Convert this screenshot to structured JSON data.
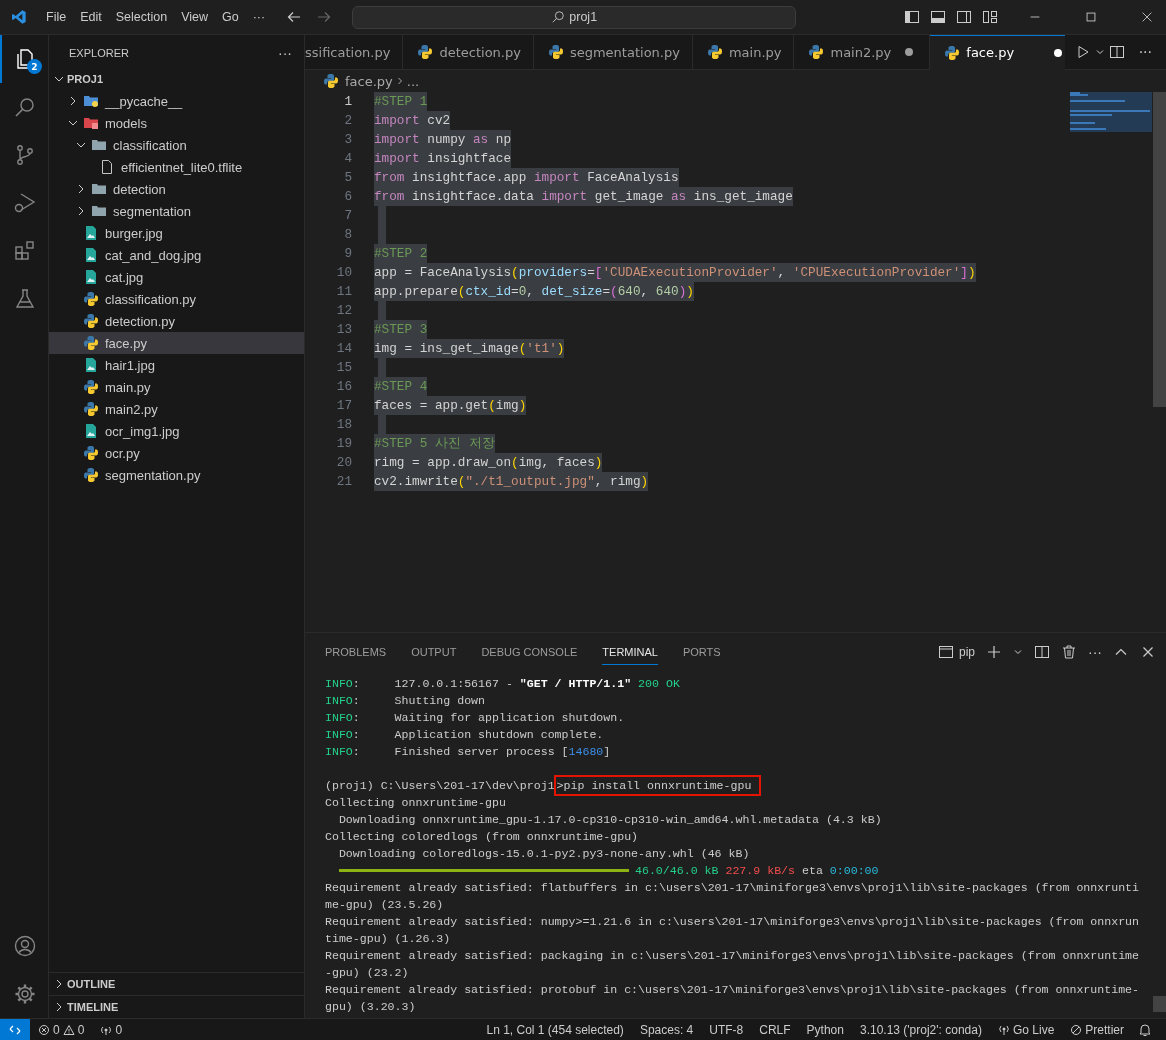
{
  "title_bar": {
    "menu": [
      "File",
      "Edit",
      "Selection",
      "View",
      "Go",
      "···"
    ],
    "search": "proj1"
  },
  "activity_bar": {
    "badge": "2"
  },
  "explorer": {
    "title": "EXPLORER",
    "more": "···",
    "root": "PROJ1",
    "tree": [
      {
        "name": "__pycache__",
        "kind": "pyfolder",
        "expanded": false,
        "selected": false
      },
      {
        "name": "models",
        "kind": "redfolder",
        "expanded": true,
        "selected": false,
        "children": [
          {
            "name": "classification",
            "kind": "folder",
            "expanded": true,
            "selected": false,
            "children": [
              {
                "name": "efficientnet_lite0.tflite",
                "kind": "file",
                "selected": false
              }
            ]
          },
          {
            "name": "detection",
            "kind": "folder",
            "expanded": false,
            "selected": false
          },
          {
            "name": "segmentation",
            "kind": "folder",
            "expanded": false,
            "selected": false
          }
        ]
      },
      {
        "name": "burger.jpg",
        "kind": "image",
        "selected": false
      },
      {
        "name": "cat_and_dog.jpg",
        "kind": "image",
        "selected": false
      },
      {
        "name": "cat.jpg",
        "kind": "image",
        "selected": false
      },
      {
        "name": "classification.py",
        "kind": "python",
        "selected": false
      },
      {
        "name": "detection.py",
        "kind": "python",
        "selected": false
      },
      {
        "name": "face.py",
        "kind": "python",
        "selected": true
      },
      {
        "name": "hair1.jpg",
        "kind": "image",
        "selected": false
      },
      {
        "name": "main.py",
        "kind": "python",
        "selected": false
      },
      {
        "name": "main2.py",
        "kind": "python",
        "selected": false
      },
      {
        "name": "ocr_img1.jpg",
        "kind": "image",
        "selected": false
      },
      {
        "name": "ocr.py",
        "kind": "python",
        "selected": false
      },
      {
        "name": "segmentation.py",
        "kind": "python",
        "selected": false
      }
    ]
  },
  "tabs": [
    {
      "label": "ssification.py",
      "selected": false,
      "modified": false,
      "icon": false
    },
    {
      "label": "detection.py",
      "selected": false,
      "modified": false,
      "icon": true
    },
    {
      "label": "segmentation.py",
      "selected": false,
      "modified": false,
      "icon": true
    },
    {
      "label": "main.py",
      "selected": false,
      "modified": false,
      "icon": true
    },
    {
      "label": "main2.py",
      "selected": false,
      "modified": true,
      "icon": true
    },
    {
      "label": "face.py",
      "selected": true,
      "modified": true,
      "icon": true
    }
  ],
  "editor_actions_more": "···",
  "breadcrumb": {
    "file": "face.py",
    "rest": "..."
  },
  "editor": {
    "lines": [
      {
        "n": "1",
        "current": true,
        "selected": true,
        "tokens": [
          {
            "t": "#STEP 1",
            "kind": "cm"
          }
        ]
      },
      {
        "n": "2",
        "current": false,
        "selected": true,
        "tokens": [
          {
            "t": "import",
            "kind": "kw"
          },
          {
            "t": " cv2",
            "kind": "p"
          }
        ]
      },
      {
        "n": "3",
        "current": false,
        "selected": true,
        "tokens": [
          {
            "t": "import",
            "kind": "kw"
          },
          {
            "t": " numpy ",
            "kind": "p"
          },
          {
            "t": "as",
            "kind": "kw"
          },
          {
            "t": " np",
            "kind": "p"
          }
        ]
      },
      {
        "n": "4",
        "current": false,
        "selected": true,
        "tokens": [
          {
            "t": "import",
            "kind": "kw"
          },
          {
            "t": " insightface",
            "kind": "p"
          }
        ]
      },
      {
        "n": "5",
        "current": false,
        "selected": true,
        "tokens": [
          {
            "t": "from",
            "kind": "kw"
          },
          {
            "t": " insightface.app ",
            "kind": "p"
          },
          {
            "t": "import",
            "kind": "kw"
          },
          {
            "t": " FaceAnalysis",
            "kind": "p"
          }
        ]
      },
      {
        "n": "6",
        "current": false,
        "selected": true,
        "tokens": [
          {
            "t": "from",
            "kind": "kw"
          },
          {
            "t": " insightface.data ",
            "kind": "p"
          },
          {
            "t": "import",
            "kind": "kw"
          },
          {
            "t": " get_image ",
            "kind": "p"
          },
          {
            "t": "as",
            "kind": "kw"
          },
          {
            "t": " ins_get_image",
            "kind": "p"
          }
        ]
      },
      {
        "n": "7",
        "current": false,
        "selected": true
      },
      {
        "n": "8",
        "current": false,
        "selected": true
      },
      {
        "n": "9",
        "current": false,
        "selected": true,
        "tokens": [
          {
            "t": "#STEP 2",
            "kind": "cm"
          }
        ]
      },
      {
        "n": "10",
        "current": false,
        "selected": true,
        "tokens": [
          {
            "t": "app = FaceAnalysis",
            "kind": "p"
          },
          {
            "t": "(",
            "kind": "b1"
          },
          {
            "t": "providers",
            "kind": "v"
          },
          {
            "t": "=",
            "kind": "p"
          },
          {
            "t": "[",
            "kind": "b2"
          },
          {
            "t": "'CUDAExecutionProvider'",
            "kind": "s"
          },
          {
            "t": ", ",
            "kind": "p"
          },
          {
            "t": "'CPUExecutionProvider'",
            "kind": "s"
          },
          {
            "t": "]",
            "kind": "b2"
          },
          {
            "t": ")",
            "kind": "b1"
          }
        ]
      },
      {
        "n": "11",
        "current": false,
        "selected": true,
        "tokens": [
          {
            "t": "app.prepare",
            "kind": "p"
          },
          {
            "t": "(",
            "kind": "b1"
          },
          {
            "t": "ctx_id",
            "kind": "v"
          },
          {
            "t": "=",
            "kind": "p"
          },
          {
            "t": "0",
            "kind": "n"
          },
          {
            "t": ", ",
            "kind": "p"
          },
          {
            "t": "det_size",
            "kind": "v"
          },
          {
            "t": "=",
            "kind": "p"
          },
          {
            "t": "(",
            "kind": "b2"
          },
          {
            "t": "640",
            "kind": "n"
          },
          {
            "t": ", ",
            "kind": "p"
          },
          {
            "t": "640",
            "kind": "n"
          },
          {
            "t": ")",
            "kind": "b2"
          },
          {
            "t": ")",
            "kind": "b1"
          }
        ]
      },
      {
        "n": "12",
        "current": false,
        "selected": true
      },
      {
        "n": "13",
        "current": false,
        "selected": true,
        "tokens": [
          {
            "t": "#STEP 3",
            "kind": "cm"
          }
        ]
      },
      {
        "n": "14",
        "current": false,
        "selected": true,
        "tokens": [
          {
            "t": "img = ins_get_image",
            "kind": "p"
          },
          {
            "t": "(",
            "kind": "b1"
          },
          {
            "t": "'t1'",
            "kind": "s"
          },
          {
            "t": ")",
            "kind": "b1"
          }
        ]
      },
      {
        "n": "15",
        "current": false,
        "selected": true
      },
      {
        "n": "16",
        "current": false,
        "selected": true,
        "tokens": [
          {
            "t": "#STEP 4",
            "kind": "cm"
          }
        ]
      },
      {
        "n": "17",
        "current": false,
        "selected": true,
        "tokens": [
          {
            "t": "faces = app.get",
            "kind": "p"
          },
          {
            "t": "(",
            "kind": "b1"
          },
          {
            "t": "img",
            "kind": "p"
          },
          {
            "t": ")",
            "kind": "b1"
          }
        ]
      },
      {
        "n": "18",
        "current": false,
        "selected": true
      },
      {
        "n": "19",
        "current": false,
        "selected": true,
        "tokens": [
          {
            "t": "#STEP 5 사진 저장",
            "kind": "cm"
          }
        ]
      },
      {
        "n": "20",
        "current": false,
        "selected": true,
        "tokens": [
          {
            "t": "rimg = app.draw_on",
            "kind": "p"
          },
          {
            "t": "(",
            "kind": "b1"
          },
          {
            "t": "img, faces",
            "kind": "p"
          },
          {
            "t": ")",
            "kind": "b1"
          }
        ]
      },
      {
        "n": "21",
        "current": false,
        "selected": true,
        "tokens": [
          {
            "t": "cv2.imwrite",
            "kind": "p"
          },
          {
            "t": "(",
            "kind": "b1"
          },
          {
            "t": "\"./t1_output.jpg\"",
            "kind": "s"
          },
          {
            "t": ", rimg",
            "kind": "p"
          },
          {
            "t": ")",
            "kind": "b1"
          }
        ]
      }
    ]
  },
  "panel": {
    "tabs": [
      {
        "label": "PROBLEMS",
        "selected": false
      },
      {
        "label": "OUTPUT",
        "selected": false
      },
      {
        "label": "DEBUG CONSOLE",
        "selected": false
      },
      {
        "label": "TERMINAL",
        "selected": true
      },
      {
        "label": "PORTS",
        "selected": false
      }
    ],
    "terminal_name": "pip",
    "more": "···",
    "lines": [
      {
        "kind": "text",
        "segs": [
          {
            "t": "INFO",
            "kind": "green"
          },
          {
            "t": ":     127.0.0.1:56167 - ",
            "kind": "p"
          },
          {
            "t": "\"GET / HTTP/1.1\"",
            "kind": "bold"
          },
          {
            "t": " 200 OK",
            "kind": "green"
          }
        ]
      },
      {
        "kind": "text",
        "segs": [
          {
            "t": "INFO",
            "kind": "green"
          },
          {
            "t": ":     Shutting down",
            "kind": "p"
          }
        ]
      },
      {
        "kind": "text",
        "segs": [
          {
            "t": "INFO",
            "kind": "green"
          },
          {
            "t": ":     Waiting for application shutdown.",
            "kind": "p"
          }
        ]
      },
      {
        "kind": "text",
        "segs": [
          {
            "t": "INFO",
            "kind": "green"
          },
          {
            "t": ":     Application shutdown complete.",
            "kind": "p"
          }
        ]
      },
      {
        "kind": "text",
        "segs": [
          {
            "t": "INFO",
            "kind": "green"
          },
          {
            "t": ":     Finished server process [",
            "kind": "p"
          },
          {
            "t": "14680",
            "kind": "blue"
          },
          {
            "t": "]",
            "kind": "p"
          }
        ]
      },
      {
        "kind": "blank"
      },
      {
        "kind": "prompt",
        "prompt": "(proj1) C:\\Users\\201-17\\dev\\proj1",
        "command": ">pip install onnxruntime-gpu"
      },
      {
        "kind": "text",
        "segs": [
          {
            "t": "Collecting onnxruntime-gpu",
            "kind": "p"
          }
        ]
      },
      {
        "kind": "text",
        "segs": [
          {
            "t": "  Downloading onnxruntime_gpu-1.17.0-cp310-cp310-win_amd64.whl.metadata (4.3 kB)",
            "kind": "p"
          }
        ]
      },
      {
        "kind": "text",
        "segs": [
          {
            "t": "Collecting coloredlogs (from onnxruntime-gpu)",
            "kind": "p"
          }
        ]
      },
      {
        "kind": "text",
        "segs": [
          {
            "t": "  Downloading coloredlogs-15.0.1-py2.py3-none-any.whl (46 kB)",
            "kind": "p"
          }
        ]
      },
      {
        "kind": "progress",
        "level": 1,
        "segs": [
          {
            "t": "46.0/46.0 kB",
            "kind": "green"
          },
          {
            "t": " 227.9 kB/s",
            "kind": "red"
          },
          {
            "t": " eta ",
            "kind": "p"
          },
          {
            "t": "0:00:00",
            "kind": "cyan"
          }
        ]
      },
      {
        "kind": "text",
        "segs": [
          {
            "t": "Requirement already satisfied: flatbuffers in c:\\users\\201-17\\miniforge3\\envs\\proj1\\lib\\site-packages (from onnxrunti",
            "kind": "p"
          }
        ]
      },
      {
        "kind": "text",
        "segs": [
          {
            "t": "me-gpu) (23.5.26)",
            "kind": "p"
          }
        ]
      },
      {
        "kind": "text",
        "segs": [
          {
            "t": "Requirement already satisfied: numpy>=1.21.6 in c:\\users\\201-17\\miniforge3\\envs\\proj1\\lib\\site-packages (from onnxrun",
            "kind": "p"
          }
        ]
      },
      {
        "kind": "text",
        "segs": [
          {
            "t": "time-gpu) (1.26.3)",
            "kind": "p"
          }
        ]
      },
      {
        "kind": "text",
        "segs": [
          {
            "t": "Requirement already satisfied: packaging in c:\\users\\201-17\\miniforge3\\envs\\proj1\\lib\\site-packages (from onnxruntime",
            "kind": "p"
          }
        ]
      },
      {
        "kind": "text",
        "segs": [
          {
            "t": "-gpu) (23.2)",
            "kind": "p"
          }
        ]
      },
      {
        "kind": "text",
        "segs": [
          {
            "t": "Requirement already satisfied: protobuf in c:\\users\\201-17\\miniforge3\\envs\\proj1\\lib\\site-packages (from onnxruntime-",
            "kind": "p"
          }
        ]
      },
      {
        "kind": "text",
        "segs": [
          {
            "t": "gpu) (3.20.3)",
            "kind": "p"
          }
        ]
      }
    ]
  },
  "sections": [
    "OUTLINE",
    "TIMELINE"
  ],
  "status_bar": {
    "errors": "0",
    "warnings": "0",
    "ports": "0",
    "right": [
      "Ln 1, Col 1 (454 selected)",
      "Spaces: 4",
      "UTF-8",
      "CRLF",
      "Python",
      "3.10.13 ('proj2': conda)",
      "Go Live",
      "Prettier"
    ]
  }
}
